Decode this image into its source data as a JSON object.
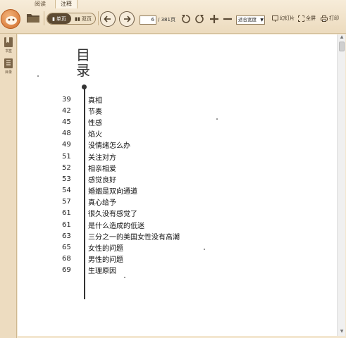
{
  "app": {
    "tabs": [
      {
        "label": "阅读",
        "active": false
      },
      {
        "label": "注释",
        "active": true
      }
    ]
  },
  "toolbar": {
    "view_single": "单页",
    "view_double": "双页",
    "page_current": "6",
    "page_total": "/ 381页",
    "zoom_option": "适合宽度",
    "slideshow_label": "幻灯片",
    "fullscreen_label": "全屏",
    "print_label": "打印"
  },
  "sidebar": {
    "items": [
      {
        "label": "书签",
        "icon": "bookmark-icon"
      },
      {
        "label": "目录",
        "icon": "toc-icon"
      }
    ]
  },
  "document": {
    "toc_title": "目录",
    "entries": [
      {
        "page": "39",
        "title": "真相"
      },
      {
        "page": "42",
        "title": "节奏"
      },
      {
        "page": "45",
        "title": "性感"
      },
      {
        "page": "48",
        "title": "焰火"
      },
      {
        "page": "49",
        "title": "没情绪怎么办"
      },
      {
        "page": "51",
        "title": "关注对方"
      },
      {
        "page": "52",
        "title": "相亲相爱"
      },
      {
        "page": "53",
        "title": "感觉良好"
      },
      {
        "page": "54",
        "title": "婚姻是双向通道"
      },
      {
        "page": "57",
        "title": "真心给予"
      },
      {
        "page": "61",
        "title": "很久没有感觉了"
      },
      {
        "page": "61",
        "title": "是什么造成的低迷"
      },
      {
        "page": "63",
        "title": "三分之一的美国女性没有高潮"
      },
      {
        "page": "65",
        "title": "女性的问题"
      },
      {
        "page": "68",
        "title": "男性的问题"
      },
      {
        "page": "69",
        "title": "生理原因"
      }
    ]
  },
  "colors": {
    "ribbon": "#ecdbbe",
    "accent_dark": "#5d4a32",
    "page": "#ffffff"
  }
}
